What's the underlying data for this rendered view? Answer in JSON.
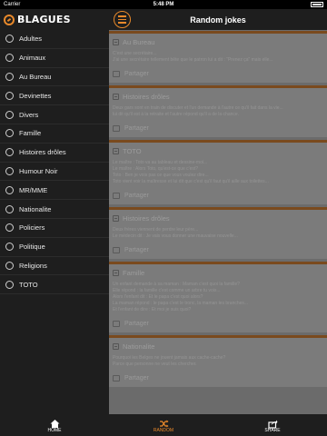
{
  "status_bar": {
    "carrier": "Carrier",
    "time": "5:48 PM"
  },
  "sidebar": {
    "logo_text": "BLAGUES",
    "categories": [
      "Adultes",
      "Animaux",
      "Au Bureau",
      "Devinettes",
      "Divers",
      "Famille",
      "Histoires drôles",
      "Humour Noir",
      "MR/MME",
      "Nationalite",
      "Policiers",
      "Politique",
      "Religions",
      "TOTO"
    ]
  },
  "header": {
    "title": "Random jokes"
  },
  "cards": [
    {
      "title": "Au Bureau",
      "lines": [
        "C'est une secrétaire...",
        "J'ai une secrétaire tellement bête que le patron lui a dit : \"Prenez ça\" mais elle..."
      ],
      "share": "Partager"
    },
    {
      "title": "Histoires drôles",
      "lines": [
        "Deux gars sont en train de discuter et l'un demande à l'autre ce qu'il fait dans la vie...",
        "lui dit qu'il est à la retraite et l'autre répond qu'il a de la chance."
      ],
      "share": "Partager"
    },
    {
      "title": "TOTO",
      "lines": [
        "Le maître : Toto va au tableau et dessine-moi...",
        "Le maître : Alors Toto, qu'est-ce que c'est?",
        "Toto : Ben je vois pas ce que vous voulez dire...",
        "Toto vient voir la maîtresse et lui dit que c'est qu'il faut qu'il aille aux toilettes..."
      ],
      "share": "Partager"
    },
    {
      "title": "Histoires drôles",
      "lines": [
        "Deux frères viennent de perdre leur père...",
        "Le médecin dit : Je vais vous donner une mauvaise nouvelle..."
      ],
      "share": "Partager"
    },
    {
      "title": "Famille",
      "lines": [
        "Un enfant demande à sa maman : Maman c'est quoi la famille?",
        "Elle répond : la famille c'est comme un arbre tu vois...",
        "Alors l'enfant dit : Et le papa c'est quoi alors?",
        "La maman répond : le papa c'est le tronc, la maman les branches...",
        "Et l'enfant de dire : Et moi je suis quoi?"
      ],
      "share": "Partager"
    },
    {
      "title": "Nationalite",
      "lines": [
        "Pourquoi les Belges ne jouent jamais aux cache-cache?",
        "Parce que personne ne veut les chercher."
      ],
      "share": "Partager"
    }
  ],
  "tabs": [
    {
      "label": "HOME",
      "icon": "home-icon"
    },
    {
      "label": "RANDOM",
      "icon": "shuffle-icon"
    },
    {
      "label": "SHARE",
      "icon": "share-icon"
    }
  ],
  "colors": {
    "accent": "#e8892b",
    "sidebar_bg": "#1e1e1e",
    "overlay_bg": "#6b6b6b"
  }
}
